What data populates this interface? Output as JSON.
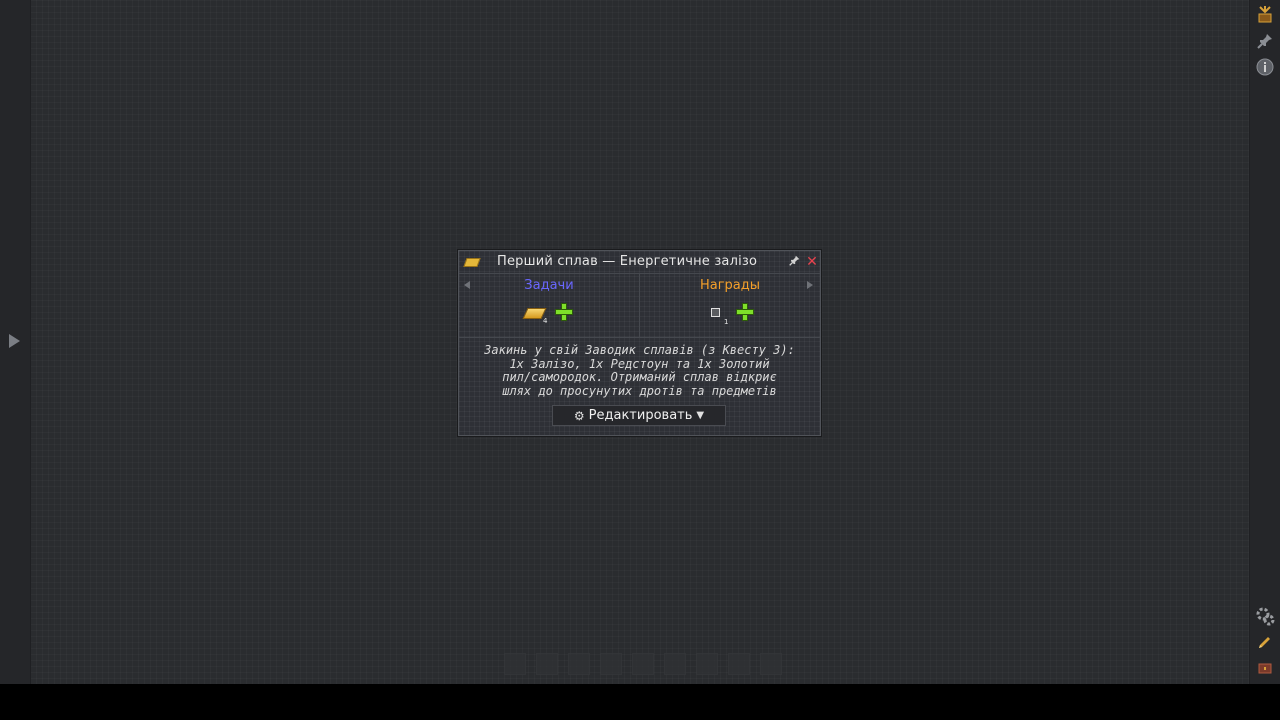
{
  "dialog": {
    "title": "Перший сплав — Енергетичне залізо",
    "pin_icon": "pin-icon",
    "close_icon": "close-icon",
    "close_glyph": "✕",
    "pin_glyph": "📌"
  },
  "tabs": {
    "tasks_label": "Задачи",
    "rewards_label": "Награды",
    "tasks_color": "#6a67ff",
    "rewards_color": "#f5a02a"
  },
  "tasks": {
    "items": [
      {
        "icon": "gold-ingot-icon",
        "count": "4"
      }
    ]
  },
  "rewards": {
    "items": [
      {
        "icon": "item-frame-icon",
        "count": "1"
      }
    ]
  },
  "description": {
    "line1": "Закинь у свій Заводик сплавів (з Квесту 3):",
    "line2": "1х Залізо, 1х Редстоун та 1х Золотий",
    "line3": "пил/самородок. Отриманий сплав відкриє",
    "line4": "шлях до просунутих дротів та предметів"
  },
  "edit_button": {
    "label": "Редактировать",
    "gear_glyph": "⚙",
    "dropdown_glyph": "▼"
  },
  "side_icons": [
    "quest-book-icon",
    "pin-icon",
    "info-icon",
    "settings-puzzle-icon",
    "pencil-icon",
    "chest-icon"
  ]
}
